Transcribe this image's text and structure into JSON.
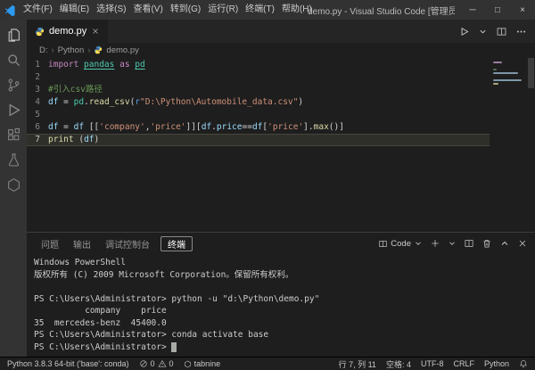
{
  "window": {
    "title": "demo.py - Visual Studio Code [管理员]",
    "menus": [
      "文件(F)",
      "编辑(E)",
      "选择(S)",
      "查看(V)",
      "转到(G)",
      "运行(R)",
      "终端(T)",
      "帮助(H)"
    ],
    "controls": {
      "minimize": "─",
      "maximize": "□",
      "close": "×"
    }
  },
  "editor_tabs": {
    "active": "demo.py"
  },
  "breadcrumb": {
    "items": [
      "D:",
      "Python",
      "demo.py"
    ]
  },
  "editor": {
    "lines": [
      {
        "n": "1",
        "tokens": [
          [
            "kw",
            "import "
          ],
          [
            "modu",
            "pandas"
          ],
          [
            "kw",
            " as "
          ],
          [
            "modu",
            "pd"
          ]
        ]
      },
      {
        "n": "2",
        "tokens": []
      },
      {
        "n": "3",
        "tokens": [
          [
            "com",
            "#引入csv路径"
          ]
        ]
      },
      {
        "n": "4",
        "tokens": [
          [
            "var",
            "df"
          ],
          [
            "pln",
            " = "
          ],
          [
            "mod",
            "pd"
          ],
          [
            "pln",
            "."
          ],
          [
            "fn",
            "read_csv"
          ],
          [
            "pln",
            "("
          ],
          [
            "strp",
            "r"
          ],
          [
            "str",
            "\"D:\\Python\\Automobile_data.csv\""
          ],
          [
            "pln",
            ")"
          ]
        ]
      },
      {
        "n": "5",
        "tokens": []
      },
      {
        "n": "6",
        "tokens": [
          [
            "var",
            "df"
          ],
          [
            "pln",
            " = "
          ],
          [
            "var",
            "df"
          ],
          [
            "pln",
            " [["
          ],
          [
            "str",
            "'company'"
          ],
          [
            "pln",
            ","
          ],
          [
            "str",
            "'price'"
          ],
          [
            "pln",
            "]]["
          ],
          [
            "var",
            "df"
          ],
          [
            "pln",
            "."
          ],
          [
            "var",
            "price"
          ],
          [
            "pln",
            "=="
          ],
          [
            "var",
            "df"
          ],
          [
            "pln",
            "["
          ],
          [
            "str",
            "'price'"
          ],
          [
            "pln",
            "]."
          ],
          [
            "fn",
            "max"
          ],
          [
            "pln",
            "()]"
          ]
        ]
      },
      {
        "n": "7",
        "active": true,
        "tokens": [
          [
            "fn",
            "print"
          ],
          [
            "pln",
            " ("
          ],
          [
            "var",
            "df"
          ],
          [
            "pln",
            ")"
          ]
        ]
      }
    ]
  },
  "panel": {
    "tabs": [
      {
        "label": "问题"
      },
      {
        "label": "输出"
      },
      {
        "label": "调试控制台"
      },
      {
        "label": "终端",
        "active": true
      }
    ],
    "shell_label": "Code",
    "terminal": {
      "lines": [
        "Windows PowerShell",
        "版权所有 (C) 2009 Microsoft Corporation。保留所有权利。",
        "",
        "PS C:\\Users\\Administrator> python -u \"d:\\Python\\demo.py\"",
        "          company    price",
        "35  mercedes-benz  45400.0",
        "PS C:\\Users\\Administrator> conda activate base",
        "PS C:\\Users\\Administrator> "
      ]
    }
  },
  "status_bar": {
    "python_version": "Python 3.8.3 64-bit ('base': conda)",
    "errors": "0",
    "warnings": "0",
    "tabnine": "tabnine",
    "line_col": "行 7, 列 11",
    "spaces": "空格: 4",
    "encoding": "UTF-8",
    "eol": "CRLF",
    "language": "Python"
  },
  "colors": {
    "accent": "#007acc",
    "keyword": "#c586c0",
    "string": "#ce9178",
    "function": "#dcdcaa",
    "variable": "#9cdcfe",
    "comment": "#6a9955",
    "module": "#4ec9b0"
  }
}
